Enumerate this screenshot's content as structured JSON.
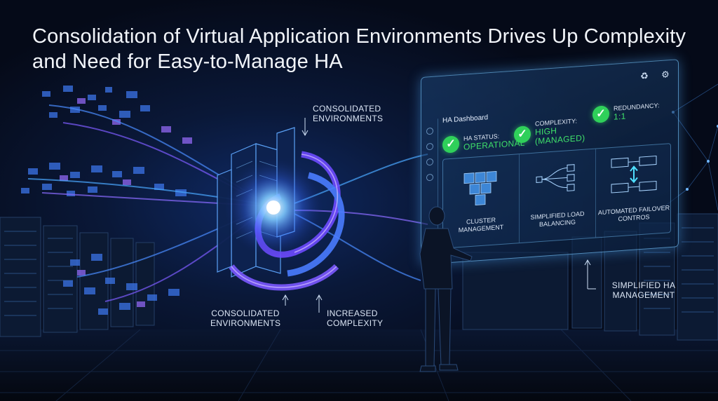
{
  "title": "Consolidation of Virtual Application Environments Drives Up Complexity and Need for Easy-to-Manage HA",
  "labels": {
    "consolidated_top": "CONSOLIDATED ENVIRONMENTS",
    "consolidated_bottom": "CONSOLIDATED ENVIRONMENTS",
    "increased_complexity": "INCREASED COMPLEXITY",
    "simplified_ha": "SIMPLIFIED HA MANAGEMENT"
  },
  "dashboard": {
    "title": "HA Dashboard",
    "statuses": [
      {
        "label": "HA STATUS:",
        "value": "OPERATIONAL"
      },
      {
        "label": "COMPLEXITY:",
        "value": "HIGH (MANAGED)"
      },
      {
        "label": "REDUNDANCY:",
        "value": "1:1"
      }
    ],
    "tiles": [
      {
        "label": "CLUSTER MANAGEMENT",
        "icon": "cubes-icon"
      },
      {
        "label": "SIMPLIFIED LOAD BALANCING",
        "icon": "branch-icon"
      },
      {
        "label": "AUTOMATED FAILOVER CONTROS",
        "icon": "failover-icon"
      }
    ],
    "header_icons": [
      "bell-icon",
      "gear-icon"
    ]
  },
  "colors": {
    "accent": "#3fe06a",
    "glow": "#4aa8ff",
    "purple": "#9a5cff"
  }
}
